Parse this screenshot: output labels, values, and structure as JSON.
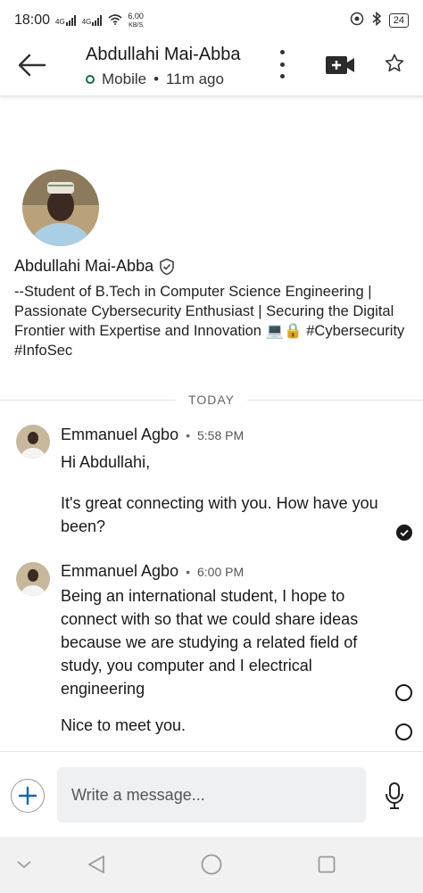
{
  "status_bar": {
    "time": "18:00",
    "signal1": "4G",
    "signal2": "4G",
    "net_speed_value": "6.00",
    "net_speed_unit": "KB/S",
    "battery": "24"
  },
  "header": {
    "name": "Abdullahi Mai-Abba",
    "device": "Mobile",
    "separator": "•",
    "last_active": "11m ago"
  },
  "profile": {
    "name": "Abdullahi Mai-Abba",
    "headline": "--Student of B.Tech in Computer Science Engineering | Passionate Cybersecurity Enthusiast | Securing the Digital Frontier with Expertise and Innovation 💻🔒 #Cybersecurity #InfoSec"
  },
  "divider": {
    "label": "TODAY"
  },
  "messages": [
    {
      "sender": "Emmanuel Agbo",
      "separator": "•",
      "time": "5:58 PM",
      "text_1": "Hi Abdullahi,",
      "text_2": "It's great connecting with you. How have you been?"
    },
    {
      "sender": "Emmanuel Agbo",
      "separator": "•",
      "time": "6:00 PM",
      "text_1": "Being an international student, I hope to connect with so that we could share ideas because we are studying a related field of study, you computer and I electrical engineering",
      "text_2": "Nice to meet you."
    }
  ],
  "composer": {
    "placeholder": "Write a message..."
  },
  "colors": {
    "brand_blue": "#0a66c2",
    "online_green": "#057642",
    "input_bg": "#eef0f2"
  },
  "icons": [
    "back-arrow-icon",
    "more-vertical-icon",
    "video-call-icon",
    "star-icon",
    "verified-shield-icon",
    "check-circle-icon",
    "plus-icon",
    "microphone-icon"
  ]
}
